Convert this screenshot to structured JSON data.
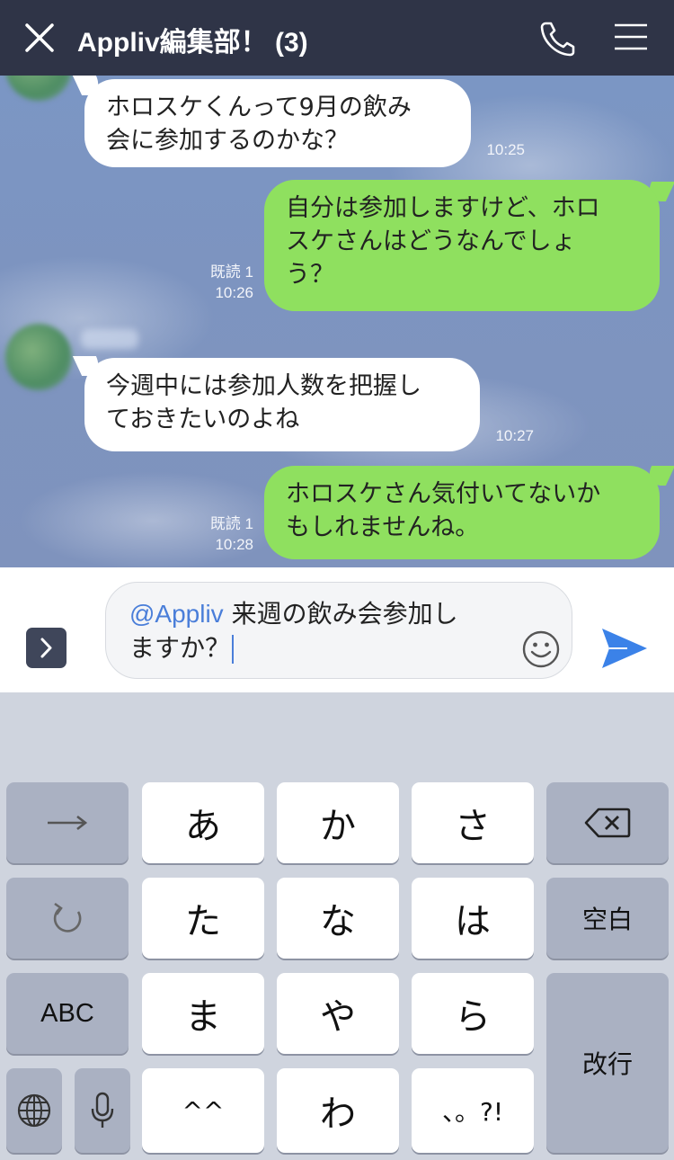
{
  "header": {
    "title": "Appliv編集部！ (3)",
    "close_icon": "close-icon",
    "call_icon": "phone-icon",
    "menu_icon": "menu-icon",
    "bg_color": "#2f3447"
  },
  "messages": [
    {
      "side": "in",
      "text": "ホロスケくんって9月の飲み\n会に参加するのかな？",
      "time": "10:25"
    },
    {
      "side": "out",
      "text": "自分は参加しますけど、ホロ\nスケさんはどうなんでしょ\nう？",
      "read": "既読 1",
      "time": "10:26"
    },
    {
      "side": "in",
      "text": "今週中には参加人数を把握し\nておきたいのよね",
      "time": "10:27"
    },
    {
      "side": "out",
      "text": "ホロスケさん気付いてないか\nもしれませんね。",
      "read": "既読 1",
      "time": "10:28"
    }
  ],
  "input": {
    "mention": "@Appliv",
    "text_line1": " 来週の飲み会参加し",
    "text_line2": "ますか？",
    "expand_icon": "chevron-right-icon",
    "emoji_icon": "smiley-icon",
    "send_icon": "send-icon"
  },
  "keyboard": {
    "rows": [
      [
        "→",
        "あ",
        "か",
        "さ",
        "⌫"
      ],
      [
        "↺",
        "た",
        "な",
        "は",
        "空白"
      ],
      [
        "ABC",
        "ま",
        "や",
        "ら",
        "改行"
      ],
      [
        "🌐",
        "🎤",
        "^^",
        "わ",
        "、。?!"
      ]
    ],
    "keys": {
      "next": "→",
      "a": "あ",
      "ka": "か",
      "sa": "さ",
      "ta": "た",
      "na": "な",
      "ha": "は",
      "space": "空白",
      "abc": "ABC",
      "ma": "ま",
      "ya": "や",
      "ra": "ら",
      "enter": "改行",
      "kaomoji": "^^",
      "wa": "わ",
      "punct": "、。?!"
    },
    "icons": {
      "next": "arrow-right-icon",
      "undo": "undo-icon",
      "delete": "backspace-icon",
      "globe": "globe-icon",
      "mic": "microphone-icon"
    }
  },
  "colors": {
    "bubble_out": "#8fe05f",
    "bubble_in": "#ffffff",
    "accent": "#4a7ed9"
  }
}
